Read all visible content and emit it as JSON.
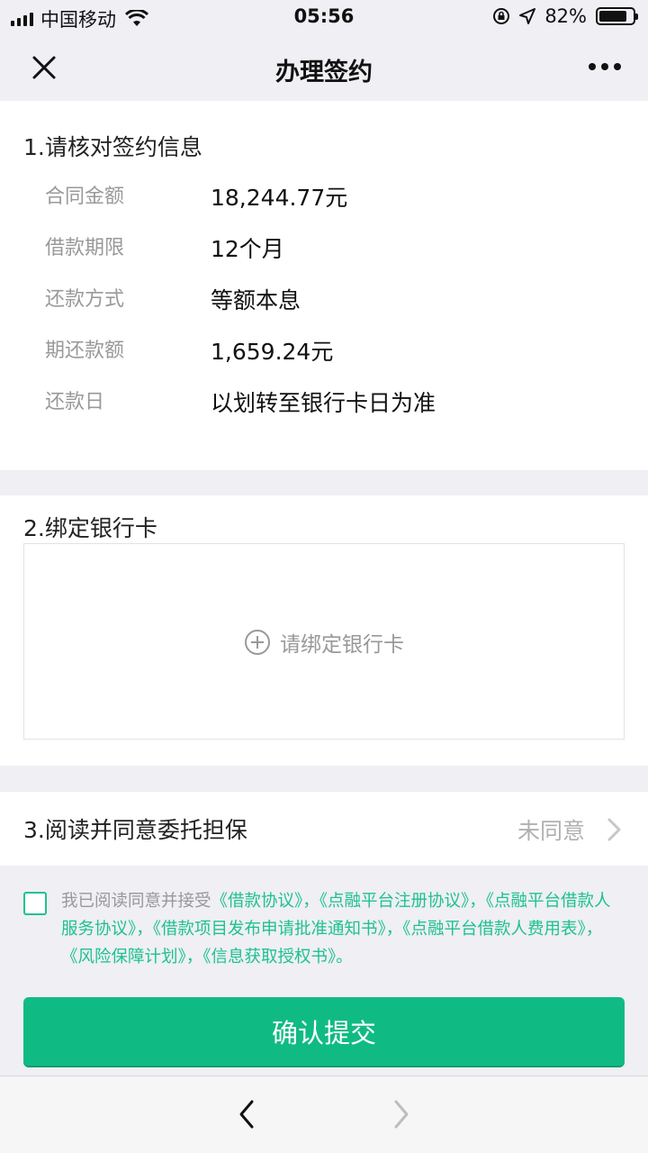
{
  "status_bar": {
    "carrier": "中国移动",
    "time": "05:56",
    "battery": "82%",
    "battery_level": 0.82
  },
  "nav": {
    "title": "办理签约"
  },
  "section1": {
    "title": "1.请核对签约信息",
    "rows": [
      {
        "label": "合同金额",
        "value": "18,244.77元"
      },
      {
        "label": "借款期限",
        "value": "12个月"
      },
      {
        "label": "还款方式",
        "value": "等额本息"
      },
      {
        "label": "期还款额",
        "value": "1,659.24元"
      },
      {
        "label": "还款日",
        "value": "以划转至银行卡日为准"
      }
    ]
  },
  "section2": {
    "title": "2.绑定银行卡",
    "bind_label": "请绑定银行卡"
  },
  "section3": {
    "title": "3.阅读并同意委托担保",
    "status": "未同意"
  },
  "agreement": {
    "intro": "我已阅读同意并接受",
    "items": [
      "《借款协议》，",
      "《点融平台注册协议》，",
      "《点融平台借款人服务协议》，",
      "《借款项目发布申请批准通知书》，",
      "《点融平台借款人费用表》，",
      "《风险保障计划》，",
      "《信息获取授权书》。"
    ]
  },
  "confirm_button": "确认提交",
  "colors": {
    "accent": "#10bb83",
    "link": "#1ec28e",
    "muted": "#999999"
  }
}
